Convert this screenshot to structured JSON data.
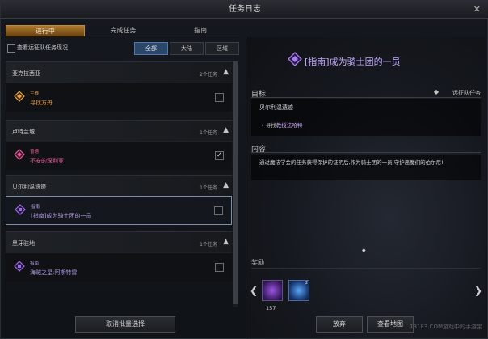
{
  "window": {
    "title": "任务日志"
  },
  "tabs": [
    {
      "label": "进行中",
      "active": true
    },
    {
      "label": "完成任务",
      "active": false
    },
    {
      "label": "指南",
      "active": false
    }
  ],
  "filters": {
    "view_party_label": "查看远征队任务现况",
    "view_party_checked": false,
    "scopes": [
      {
        "label": "全部",
        "active": true
      },
      {
        "label": "大陆",
        "active": false
      },
      {
        "label": "区域",
        "active": false
      }
    ]
  },
  "groups": [
    {
      "title": "亚克拉西亚",
      "count": "2个任务",
      "items": [
        {
          "type": "主线",
          "name": "寻找方舟",
          "checked": false,
          "color": "#e8a24a",
          "icon": "main-quest-icon"
        }
      ]
    },
    {
      "title": "卢特兰城",
      "count": "1个任务",
      "items": [
        {
          "type": "普通",
          "name": "不安的深利亚",
          "checked": true,
          "color": "#e65c9a",
          "icon": "normal-quest-icon"
        }
      ]
    },
    {
      "title": "贝尔利温遗迹",
      "count": "1个任务",
      "items": [
        {
          "type": "指南",
          "name": "[指南]成为骑士团的一员",
          "checked": false,
          "selected": true,
          "color": "#9b6fe0",
          "icon": "guide-quest-icon"
        }
      ]
    },
    {
      "title": "黑牙驻地",
      "count": "1个任务",
      "items": [
        {
          "type": "指南",
          "name": "海贼之星:阿斯特雷",
          "checked": false,
          "color": "#9b6fe0",
          "icon": "guide-quest-icon"
        }
      ]
    }
  ],
  "cancel_label": "取消批量选择",
  "detail": {
    "title": "[指南]成为骑士团的一员",
    "objective_label": "目标",
    "party_mission_label": "远征队任务",
    "objective_title": "贝尔利温遗迹",
    "objective_prefix": "• 寻找",
    "objective_npc": "教授法哈特",
    "content_label": "内容",
    "content_text": "通过魔法学会的任务获得保护的证明后,作为骑士团的一员,守护恶魔们的伯尔尼!",
    "reward_label": "奖励",
    "rewards": [
      {
        "count": "157",
        "badge": "",
        "kind": "purple"
      },
      {
        "count": "",
        "badge": "2",
        "kind": "blue"
      }
    ]
  },
  "buttons": {
    "abandon": "放弃",
    "track": "查看地图"
  },
  "watermark": "18183.COM游戏中的手游宝"
}
